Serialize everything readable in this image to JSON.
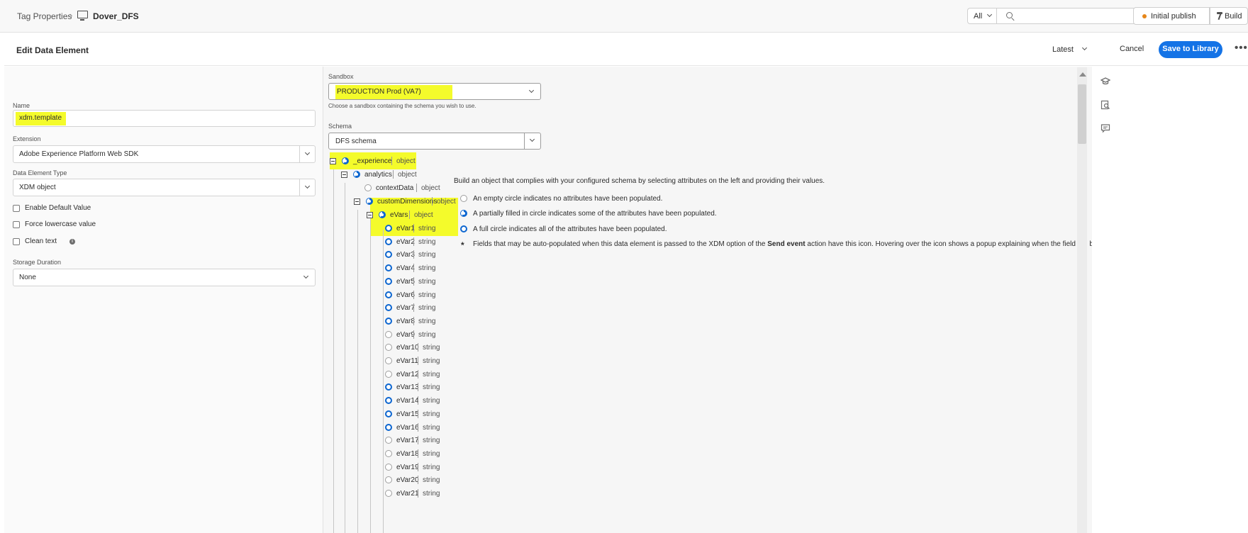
{
  "topbar": {
    "breadcrumb_root": "Tag Properties",
    "breadcrumb_sep": "›",
    "property_name": "Dover_DFS",
    "scope": "All",
    "search_placeholder": "",
    "publish_label": "Initial publish",
    "build_label": "Build"
  },
  "header": {
    "title": "Edit Data Element",
    "version": "Latest",
    "cancel": "Cancel",
    "save": "Save to Library",
    "more": "•••"
  },
  "form": {
    "name_label": "Name",
    "name_value": "xdm.template",
    "extension_label": "Extension",
    "extension_value": "Adobe Experience Platform Web SDK",
    "type_label": "Data Element Type",
    "type_value": "XDM object",
    "enable_default": "Enable Default Value",
    "force_lowercase": "Force lowercase value",
    "clean_text": "Clean text",
    "storage_label": "Storage Duration",
    "storage_value": "None"
  },
  "sandbox": {
    "label": "Sandbox",
    "value": "PRODUCTION Prod (VA7)",
    "help": "Choose a sandbox containing the schema you wish to use."
  },
  "schema": {
    "label": "Schema",
    "value": "DFS schema"
  },
  "tree": {
    "experience": {
      "name": "_experience",
      "type": "object"
    },
    "analytics": {
      "name": "analytics",
      "type": "object"
    },
    "contextData": {
      "name": "contextData",
      "type": "object"
    },
    "customDimensions": {
      "name": "customDimensions",
      "type": "object"
    },
    "eVars": {
      "name": "eVars",
      "type": "object"
    },
    "evars": [
      {
        "name": "eVar1",
        "type": "string",
        "status": "full"
      },
      {
        "name": "eVar2",
        "type": "string",
        "status": "full"
      },
      {
        "name": "eVar3",
        "type": "string",
        "status": "full"
      },
      {
        "name": "eVar4",
        "type": "string",
        "status": "full"
      },
      {
        "name": "eVar5",
        "type": "string",
        "status": "full"
      },
      {
        "name": "eVar6",
        "type": "string",
        "status": "full"
      },
      {
        "name": "eVar7",
        "type": "string",
        "status": "full"
      },
      {
        "name": "eVar8",
        "type": "string",
        "status": "full"
      },
      {
        "name": "eVar9",
        "type": "string",
        "status": "empty"
      },
      {
        "name": "eVar10",
        "type": "string",
        "status": "empty"
      },
      {
        "name": "eVar11",
        "type": "string",
        "status": "empty"
      },
      {
        "name": "eVar12",
        "type": "string",
        "status": "empty"
      },
      {
        "name": "eVar13",
        "type": "string",
        "status": "full"
      },
      {
        "name": "eVar14",
        "type": "string",
        "status": "full"
      },
      {
        "name": "eVar15",
        "type": "string",
        "status": "full"
      },
      {
        "name": "eVar16",
        "type": "string",
        "status": "full"
      },
      {
        "name": "eVar17",
        "type": "string",
        "status": "empty"
      },
      {
        "name": "eVar18",
        "type": "string",
        "status": "empty"
      },
      {
        "name": "eVar19",
        "type": "string",
        "status": "empty"
      },
      {
        "name": "eVar20",
        "type": "string",
        "status": "empty"
      },
      {
        "name": "eVar21",
        "type": "string",
        "status": "empty"
      }
    ]
  },
  "legend": {
    "intro": "Build an object that complies with your configured schema by selecting attributes on the left and providing their values.",
    "empty": "An empty circle indicates no attributes have been populated.",
    "partial": "A partially filled in circle indicates some of the attributes have been populated.",
    "full": "A full circle indicates all of the attributes have been populated.",
    "auto_pre": "Fields that may be auto-populated when this data element is passed to the XDM option of the ",
    "auto_bold": "Send event",
    "auto_post": " action have this icon. Hovering over the icon shows a popup explaining when the field will be auto-populated."
  },
  "colors": {
    "accent": "#1473e6",
    "highlight": "#f4fb2b",
    "full_circle": "#0d66d0",
    "publish_dot": "#e68619"
  }
}
